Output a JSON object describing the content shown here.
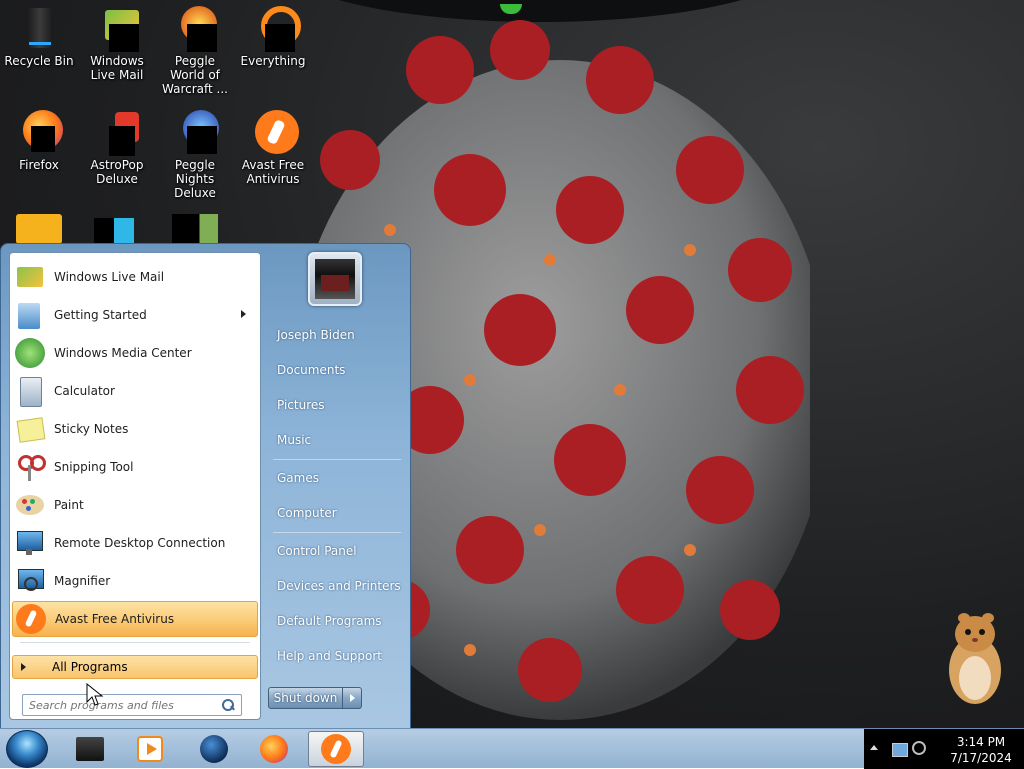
{
  "desktop": {
    "icons": [
      {
        "label": "Recycle Bin"
      },
      {
        "label": "Windows Live Mail"
      },
      {
        "label": "Peggle World of Warcraft ..."
      },
      {
        "label": "Everything"
      },
      {
        "label": "Firefox"
      },
      {
        "label": "AstroPop Deluxe"
      },
      {
        "label": "Peggle Nights Deluxe"
      },
      {
        "label": "Avast Free Antivirus"
      }
    ]
  },
  "start_menu": {
    "programs": [
      {
        "label": "Windows Live Mail",
        "icon": "mail-icon"
      },
      {
        "label": "Getting Started",
        "icon": "getting-started-icon",
        "submenu": true
      },
      {
        "label": "Windows Media Center",
        "icon": "media-center-icon"
      },
      {
        "label": "Calculator",
        "icon": "calculator-icon"
      },
      {
        "label": "Sticky Notes",
        "icon": "sticky-notes-icon"
      },
      {
        "label": "Snipping Tool",
        "icon": "scissors-icon"
      },
      {
        "label": "Paint",
        "icon": "paint-icon"
      },
      {
        "label": "Remote Desktop Connection",
        "icon": "remote-desktop-icon"
      },
      {
        "label": "Magnifier",
        "icon": "magnifier-icon"
      },
      {
        "label": "Avast Free Antivirus",
        "icon": "avast-icon",
        "highlighted": true
      }
    ],
    "all_programs": "All Programs",
    "search_placeholder": "Search programs and files",
    "right_items": [
      {
        "label": "Joseph Biden"
      },
      {
        "label": "Documents"
      },
      {
        "label": "Pictures"
      },
      {
        "label": "Music"
      },
      {
        "label": "Games"
      },
      {
        "label": "Computer"
      },
      {
        "label": "Control Panel"
      },
      {
        "label": "Devices and Printers"
      },
      {
        "label": "Default Programs"
      },
      {
        "label": "Help and Support"
      }
    ],
    "shutdown_label": "Shut down"
  },
  "taskbar": {
    "time": "3:14 PM",
    "date": "7/17/2024"
  },
  "colors": {
    "highlight": "#f8c46e",
    "menu_blue": "#8db4d8",
    "taskbar": "#a3bfdb",
    "text_dark": "#1e1e1e"
  }
}
